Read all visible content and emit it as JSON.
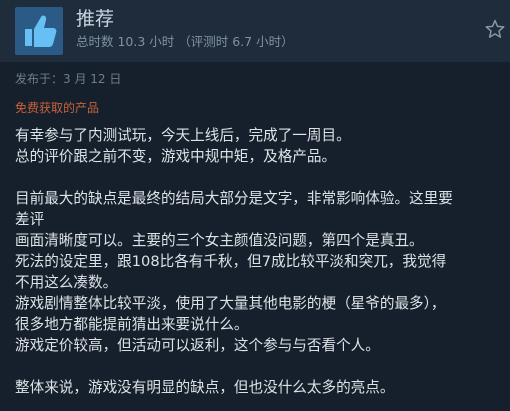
{
  "header": {
    "title": "推荐",
    "hours_text": "总时数 10.3 小时 （评测时 6.7 小时）",
    "icon": "thumbs-up-icon",
    "accent_color": "#2c5a86"
  },
  "posted_text": "发布于：3 月 12 日",
  "product_note": "免费获取的产品",
  "review": {
    "lines": [
      "有幸参与了内测试玩，今天上线后，完成了一周目。",
      "总的评价跟之前不变，游戏中规中矩，及格产品。",
      "",
      "目前最大的缺点是最终的结局大部分是文字，非常影响体验。这里要",
      "差评",
      "画面清晰度可以。主要的三个女主颜值没问题，第四个是真丑。",
      "死法的设定里，跟108比各有千秋，但7成比较平淡和突兀，我觉得",
      "不用这么凑数。",
      "游戏剧情整体比较平淡，使用了大量其他电影的梗（星爷的最多），",
      "很多地方都能提前猜出来要说什么。",
      "游戏定价较高，但活动可以返利，这个参与与否看个人。",
      "",
      "整体来说，游戏没有明显的缺点，但也没什么太多的亮点。"
    ]
  }
}
